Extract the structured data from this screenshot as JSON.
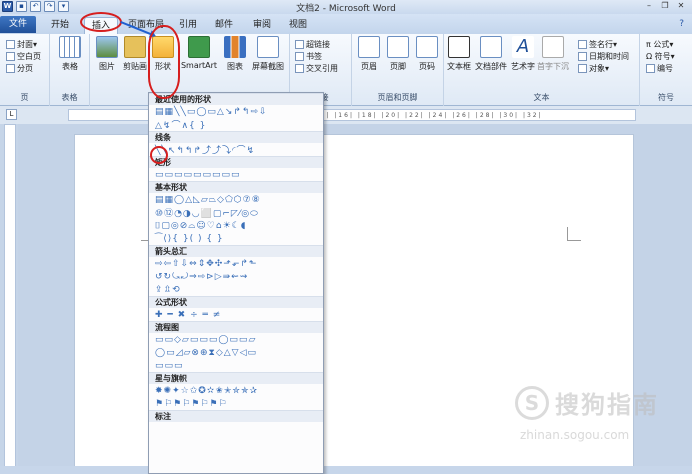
{
  "window": {
    "title": "文档2 - Microsoft Word",
    "app_icon": "W",
    "qat_icons": [
      "save-icon",
      "undo-icon",
      "redo-icon",
      "dropdown-icon"
    ]
  },
  "tabs": {
    "file": "文件",
    "items": [
      "开始",
      "插入",
      "页面布局",
      "引用",
      "邮件",
      "审阅",
      "视图"
    ],
    "active": "插入"
  },
  "ribbon": {
    "pages": {
      "items": [
        "封面▾",
        "空白页",
        "分页"
      ],
      "label": "页"
    },
    "table": {
      "button": "表格",
      "label": "表格"
    },
    "illustrations": {
      "buttons": [
        "图片",
        "剪贴画",
        "形状",
        "SmartArt",
        "图表",
        "屏幕截图"
      ],
      "label": "插图"
    },
    "links": {
      "items": [
        "超链接",
        "书签",
        "交叉引用"
      ],
      "label": "链接"
    },
    "header": {
      "buttons": [
        "页眉",
        "页脚",
        "页码"
      ],
      "label": "页眉和页脚"
    },
    "text": {
      "buttons": [
        "文本框",
        "文档部件",
        "艺术字",
        "首字下沉"
      ],
      "side": [
        "签名行▾",
        "日期和时间",
        "对象▾"
      ],
      "label": "文本"
    },
    "symbols": {
      "items": [
        "π 公式▾",
        "Ω 符号▾",
        "编号"
      ],
      "label": "符号"
    }
  },
  "ruler_numbers": "|4| |2| | |2| |4| |6| |8| |10| |12| |14| |16| |18| |20| |22| |24| |26| |28| |30| |32|",
  "shapes_menu": {
    "sections": [
      {
        "title": "最近使用的形状",
        "rows": [
          "▤▦╲╲▭◯▭△↘↱↰⇨⇩",
          "△↯⌒∧{ }"
        ]
      },
      {
        "title": "线条",
        "rows": [
          "╲╲↖↰↰↱⤴⤴⤵◜⌒↯"
        ]
      },
      {
        "title": "矩形",
        "rows": [
          "▭▭▭▭▭▭▭▭▭"
        ]
      },
      {
        "title": "基本形状",
        "rows": [
          "▤▦◯△◺▱⏢◇⬠⬡⑦⑧",
          "⑩⑫◔◑◡⬜▢⌐◸⁄◎⬭",
          "⌷▢◎⊘⌓☺♡⌂☀☾◖",
          "⁀⟨⟩{ }( ) { }"
        ]
      },
      {
        "title": "箭头总汇",
        "rows": [
          "⇨⇦⇧⇩⇔⇕✥✣⬏⬐↱⬑",
          "↺↻⤿⤾⇒⇨⊳▷⇛⇜⇝",
          "⇪⇫⟲"
        ]
      },
      {
        "title": "公式形状",
        "rows": [
          "✚ ━ ✖ ÷ ═ ≠"
        ]
      },
      {
        "title": "流程图",
        "rows": [
          "▭▭◇▱▭▭▭◯▭▭▱",
          "◯▭◿▱⊗⊕⧗◇△▽◁▭",
          "▭▭▭"
        ]
      },
      {
        "title": "星与旗帜",
        "rows": [
          "✸✺✦☆✩✪✫✬✭✮✯✰",
          "⚑⚐⚑⚐⚑⚐⚑⚐"
        ]
      },
      {
        "title": "标注",
        "rows": []
      }
    ]
  },
  "watermark": {
    "text": "搜狗指南",
    "url": "zhinan.sogou.com"
  }
}
